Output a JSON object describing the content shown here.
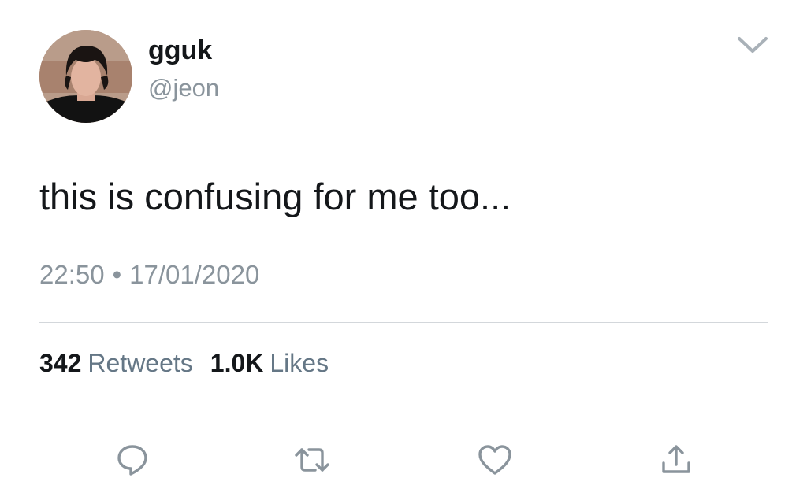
{
  "user": {
    "display_name": "gguk",
    "handle": "@jeon",
    "avatar_icon": "profile-photo"
  },
  "tweet": {
    "text": "this is confusing for me too...",
    "time": "22:50",
    "separator": "•",
    "date": "17/01/2020"
  },
  "stats": {
    "retweets_count": "342",
    "retweets_label": "Retweets",
    "likes_count": "1.0K",
    "likes_label": "Likes"
  },
  "actions": {
    "reply_icon": "reply-icon",
    "retweet_icon": "retweet-icon",
    "like_icon": "heart-icon",
    "share_icon": "share-icon"
  },
  "colors": {
    "text_primary": "#14171a",
    "text_secondary": "#8a949c",
    "icon_gray": "#8a949c",
    "divider": "#d3d7db"
  }
}
